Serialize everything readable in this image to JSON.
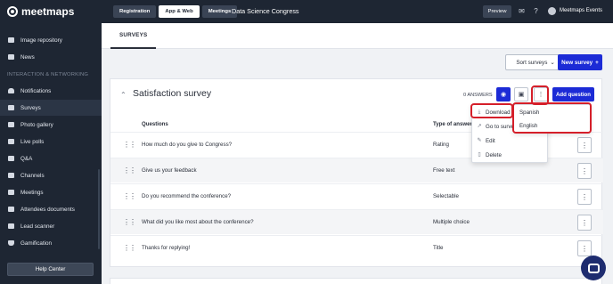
{
  "brand": {
    "logo_text": "meetmaps"
  },
  "sidebar": {
    "section_label": "INTERACTION & NETWORKING",
    "items": [
      {
        "label": "Image repository",
        "icon": "image-icon"
      },
      {
        "label": "News",
        "icon": "news-icon"
      },
      {
        "label": "Notifications",
        "icon": "bell-icon"
      },
      {
        "label": "Surveys",
        "icon": "survey-icon",
        "active": true
      },
      {
        "label": "Photo gallery",
        "icon": "photo-icon"
      },
      {
        "label": "Live polls",
        "icon": "poll-icon"
      },
      {
        "label": "Q&A",
        "icon": "qa-icon"
      },
      {
        "label": "Channels",
        "icon": "channel-icon"
      },
      {
        "label": "Meetings",
        "icon": "meeting-icon"
      },
      {
        "label": "Attendees documents",
        "icon": "document-icon"
      },
      {
        "label": "Lead scanner",
        "icon": "scanner-icon"
      },
      {
        "label": "Gamification",
        "icon": "trophy-icon"
      }
    ],
    "help_label": "Help Center"
  },
  "topbar": {
    "tabs": [
      "Registration",
      "App & Web",
      "Meetings"
    ],
    "active_tab": "App & Web",
    "event_name": "Data Science Congress",
    "preview_label": "Preview",
    "user_name": "Meetmaps Events"
  },
  "page": {
    "subtab": "SURVEYS",
    "sort_label": "Sort surveys",
    "new_survey_label": "New survey",
    "accent": "#1c2bd6"
  },
  "survey": {
    "title": "Satisfaction survey",
    "answers_label": "0 ANSWERS",
    "add_question_label": "Add question",
    "columns": {
      "questions": "Questions",
      "type": "Type of answer"
    },
    "rows": [
      {
        "question": "How much do you give to Congress?",
        "type": "Rating"
      },
      {
        "question": "Give us your feedback",
        "type": "Free text"
      },
      {
        "question": "Do you recommend the conference?",
        "type": "Selectable"
      },
      {
        "question": "What did you like most about the conference?",
        "type": "Multiple choice"
      },
      {
        "question": "Thanks for replying!",
        "type": "Title"
      }
    ]
  },
  "menu": {
    "items": [
      {
        "label": "Download",
        "icon": "download-icon"
      },
      {
        "label": "Go to survey",
        "icon": "external-link-icon"
      },
      {
        "label": "Edit",
        "icon": "edit-icon"
      },
      {
        "label": "Delete",
        "icon": "trash-icon"
      }
    ],
    "languages": [
      "Spanish",
      "English"
    ]
  }
}
